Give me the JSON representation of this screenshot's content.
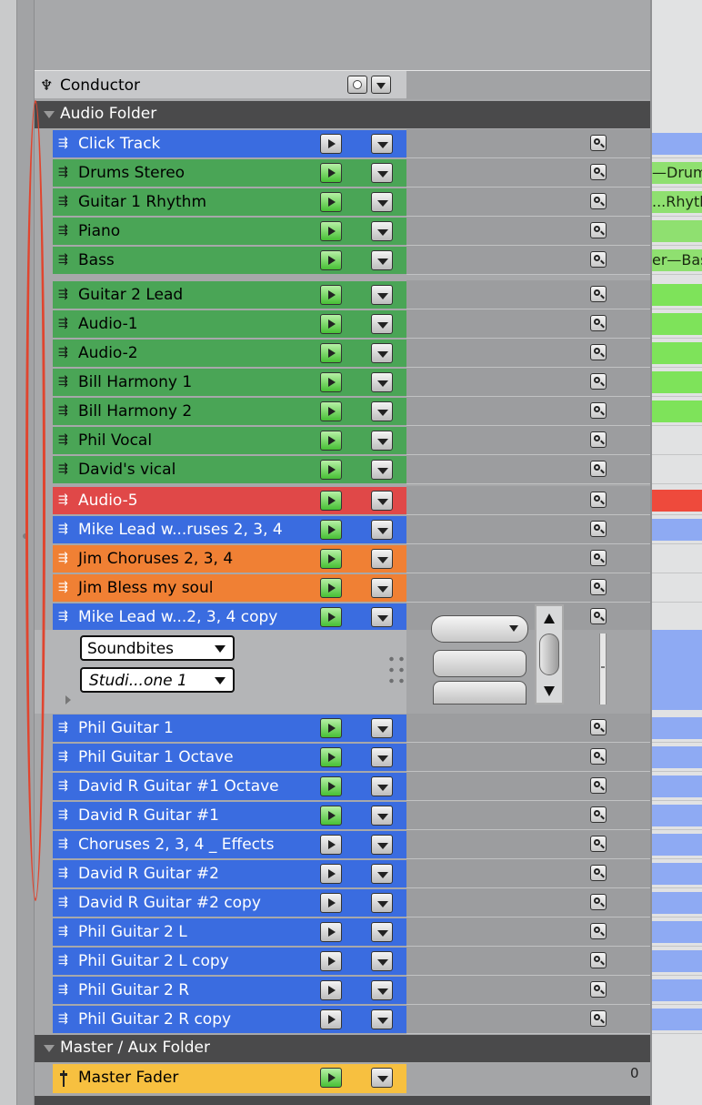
{
  "conductor": {
    "label": "Conductor"
  },
  "audio_folder": {
    "label": "Audio Folder"
  },
  "tracks": [
    {
      "name": "Click Track",
      "color": "#3a6ce0",
      "armed": false,
      "timeline": ""
    },
    {
      "name": "Drums Stereo",
      "color": "#4aa556",
      "armed": true,
      "timeline": "—Drum"
    },
    {
      "name": "Guitar 1 Rhythm",
      "color": "#4aa556",
      "armed": true,
      "timeline": "...Rhyth"
    },
    {
      "name": "Piano",
      "color": "#4aa556",
      "armed": true,
      "timeline": ""
    },
    {
      "name": "Bass",
      "color": "#4aa556",
      "armed": true,
      "timeline": "er—Bas"
    },
    {
      "name": "Guitar 2 Lead",
      "color": "#4aa556",
      "armed": true,
      "timeline": ""
    },
    {
      "name": "Audio-1",
      "color": "#4aa556",
      "armed": true,
      "timeline": ""
    },
    {
      "name": "Audio-2",
      "color": "#4aa556",
      "armed": true,
      "timeline": ""
    },
    {
      "name": "Bill Harmony 1",
      "color": "#4aa556",
      "armed": true,
      "timeline": ""
    },
    {
      "name": "Bill Harmony 2",
      "color": "#4aa556",
      "armed": true,
      "timeline": ""
    },
    {
      "name": "Phil Vocal",
      "color": "#4aa556",
      "armed": true,
      "timeline": ""
    },
    {
      "name": "David's vical",
      "color": "#4aa556",
      "armed": true,
      "timeline": ""
    },
    {
      "name": "Audio-5",
      "color": "#e04848",
      "armed": true,
      "timeline": ""
    },
    {
      "name": "Mike Lead w...ruses 2, 3, 4",
      "color": "#3a6ce0",
      "armed": true,
      "timeline": ""
    },
    {
      "name": "Jim Choruses 2, 3, 4",
      "color": "#f08034",
      "armed": true,
      "timeline": ""
    },
    {
      "name": "Jim Bless my soul",
      "color": "#f08034",
      "armed": true,
      "timeline": ""
    },
    {
      "name": "Mike Lead w...2, 3, 4 copy",
      "color": "#3a6ce0",
      "armed": true,
      "timeline": ""
    },
    {
      "name": "Phil Guitar 1",
      "color": "#3a6ce0",
      "armed": true,
      "timeline": ""
    },
    {
      "name": "Phil Guitar 1 Octave",
      "color": "#3a6ce0",
      "armed": true,
      "timeline": ""
    },
    {
      "name": "David R Guitar #1 Octave",
      "color": "#3a6ce0",
      "armed": true,
      "timeline": ""
    },
    {
      "name": "David R Guitar #1",
      "color": "#3a6ce0",
      "armed": true,
      "timeline": ""
    },
    {
      "name": "Choruses 2, 3, 4 _ Effects",
      "color": "#3a6ce0",
      "armed": false,
      "timeline": ""
    },
    {
      "name": "David R Guitar  #2",
      "color": "#3a6ce0",
      "armed": false,
      "timeline": ""
    },
    {
      "name": "David R Guitar  #2 copy",
      "color": "#3a6ce0",
      "armed": false,
      "timeline": ""
    },
    {
      "name": "Phil Guitar 2 L",
      "color": "#3a6ce0",
      "armed": false,
      "timeline": ""
    },
    {
      "name": "Phil Guitar 2 L copy",
      "color": "#3a6ce0",
      "armed": false,
      "timeline": ""
    },
    {
      "name": "Phil Guitar 2 R",
      "color": "#3a6ce0",
      "armed": false,
      "timeline": ""
    },
    {
      "name": "Phil Guitar 2 R copy",
      "color": "#3a6ce0",
      "armed": false,
      "timeline": ""
    }
  ],
  "expanded_track": {
    "soundbites_label": "Soundbites",
    "playlist_label": "Studi...one 1"
  },
  "master_folder": {
    "label": "Master / Aux Folder"
  },
  "master_fader": {
    "name": "Master Fader",
    "color": "#f7c040",
    "armed": true,
    "value": "0"
  },
  "icons": {
    "track": "audio-waveform-icon",
    "magnifier": "magnifier-icon",
    "play": "play-triangle-icon",
    "menu": "dropdown-triangle-icon",
    "conductor": "conductor-icon"
  }
}
